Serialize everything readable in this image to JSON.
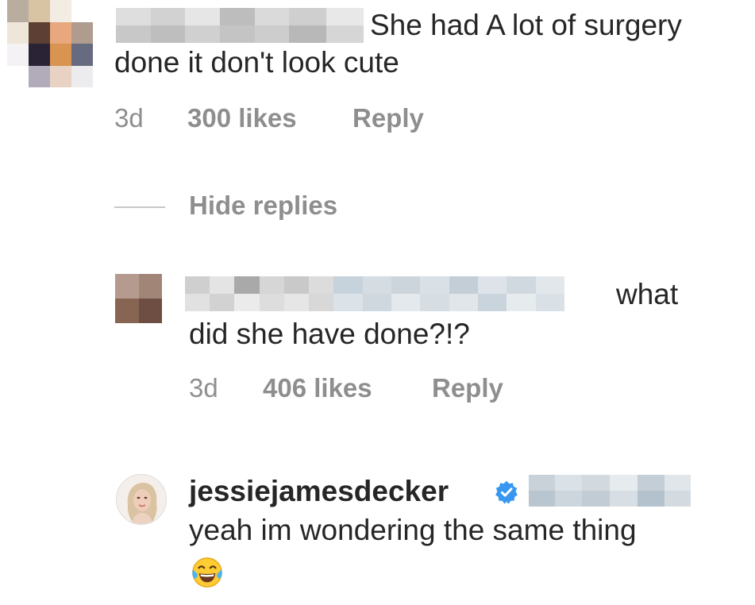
{
  "comment": {
    "text_line1": "She had A lot of surgery",
    "text_line2": "done it don't look cute",
    "time": "3d",
    "likes": "300 likes",
    "reply_label": "Reply"
  },
  "hide_replies_label": "Hide replies",
  "reply1": {
    "text_line1": "what",
    "text_line2": "did she have done?!?",
    "time": "3d",
    "likes": "406 likes",
    "reply_label": "Reply"
  },
  "reply2": {
    "username": "jessiejamesdecker",
    "text": "yeah im wondering the  same thing"
  },
  "colors": {
    "text": "#262626",
    "meta": "#8e8e8e",
    "verified": "#3897f0"
  },
  "icons": {
    "verified": "verified-badge-icon",
    "emoji": "face-with-tears-of-joy-icon"
  }
}
